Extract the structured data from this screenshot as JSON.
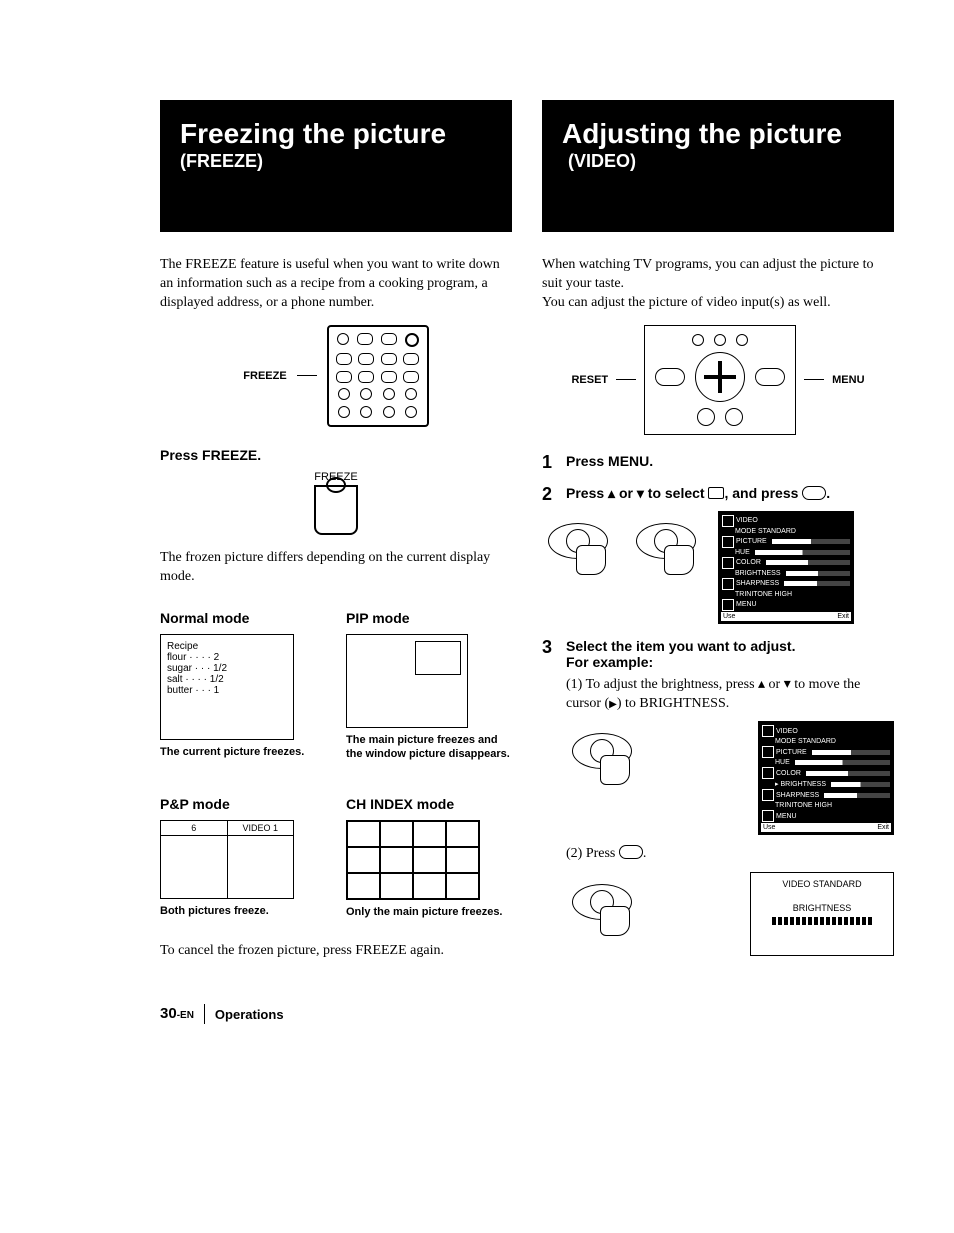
{
  "left": {
    "title": "Freezing the picture",
    "subtitle": "(FREEZE)",
    "intro": "The FREEZE feature is useful when you want to write down an information such as a recipe from a cooking program, a displayed address, or a phone number.",
    "remote_label": "FREEZE",
    "press_freeze_heading": "Press FREEZE.",
    "freeze_btn_label": "FREEZE",
    "frozen_note": "The frozen picture differs depending on the current display mode.",
    "modes": {
      "normal": {
        "label": "Normal mode",
        "recipe_title": "Recipe",
        "lines": [
          "flour · · · · 2",
          "sugar · · · 1/2",
          "salt · · · · 1/2",
          "butter · · · 1"
        ],
        "caption": "The current picture freezes."
      },
      "pip": {
        "label": "PIP mode",
        "caption": "The main picture freezes and the window picture disappears."
      },
      "pnp": {
        "label": "P&P mode",
        "tabs": [
          "6",
          "VIDEO 1"
        ],
        "caption": "Both pictures freeze."
      },
      "chindex": {
        "label": "CH INDEX mode",
        "caption": "Only the main picture freezes."
      }
    },
    "cancel": "To cancel the frozen picture, press FREEZE again."
  },
  "right": {
    "title": "Adjusting the picture",
    "subtitle": "(VIDEO)",
    "intro1": "When watching TV programs, you can adjust the picture to suit your taste.",
    "intro2": "You can adjust the picture of video input(s) as well.",
    "reset_label": "RESET",
    "menu_label": "MENU",
    "step1": "Press MENU.",
    "step2_a": "Press ",
    "step2_b": " or ",
    "step2_c": " to select ",
    "step2_d": ", and press ",
    "step2_e": ".",
    "menu_screen": {
      "header": "VIDEO",
      "mode_line": "MODE    STANDARD",
      "items": [
        "PICTURE",
        "HUE",
        "COLOR",
        "BRIGHTNESS",
        "SHARPNESS"
      ],
      "trinitone": "TRINITONE  HIGH",
      "menu_item": "MENU",
      "foot_left": "Use",
      "foot_right": "Exit"
    },
    "step3_a": "Select the item you want to adjust.",
    "step3_b": "For example:",
    "step3_1_a": "(1) To adjust the brightness, press ",
    "step3_1_b": " or ",
    "step3_1_c": " to move the cursor (",
    "step3_1_d": ") to BRIGHTNESS.",
    "step3_2_a": "(2) Press ",
    "step3_2_b": ".",
    "adjust_screen": {
      "line1": "VIDEO STANDARD",
      "line2": "BRIGHTNESS"
    }
  },
  "footer": {
    "page": "30",
    "lang": "-EN",
    "section": "Operations"
  }
}
